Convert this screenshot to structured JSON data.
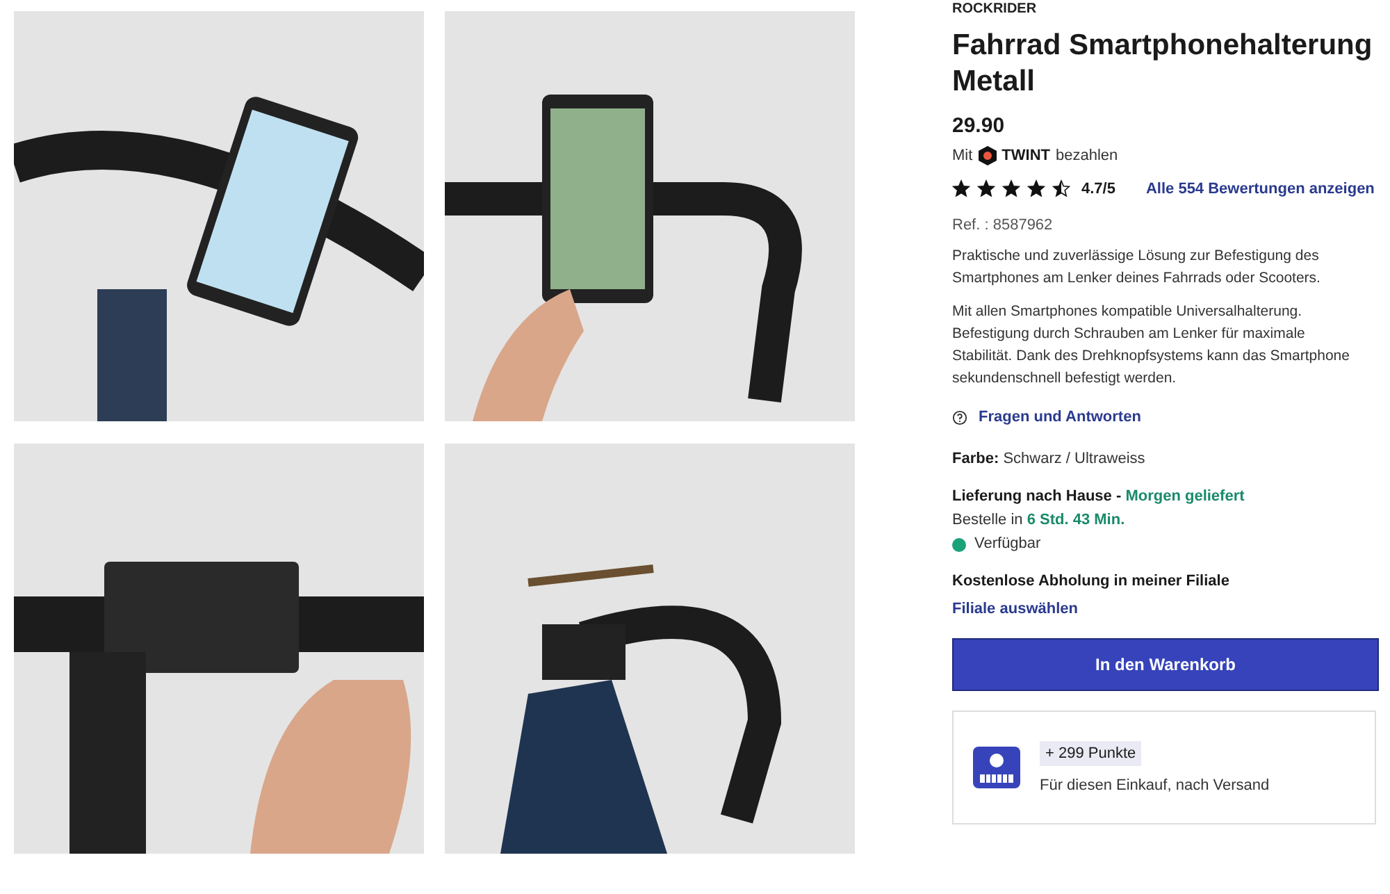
{
  "gallery": {
    "photos": [
      {
        "kind": "phone-on-handlebar"
      },
      {
        "kind": "hand-phone"
      },
      {
        "kind": "mount-closeup"
      },
      {
        "kind": "empty-mount"
      }
    ]
  },
  "product": {
    "brand": "ROCKRIDER",
    "title": "Fahrrad Smartphonehalterung Metall",
    "price": "29.90",
    "twint": {
      "prefix": "Mit",
      "brand": "TWINT",
      "suffix": "bezahlen"
    },
    "rating": {
      "stars": 4.5,
      "score": "4.7/5",
      "reviews_link": "Alle 554 Bewertungen anzeigen"
    },
    "ref": "Ref. : 8587962",
    "description": [
      "Praktische und zuverlässige Lösung zur Befestigung des Smartphones am Lenker deines Fahrrads oder Scooters.",
      "Mit allen Smartphones kompatible Universalhalterung. Befestigung durch Schrauben am Lenker für maximale Stabilität. Dank des Drehknopfsystems kann das Smartphone sekundenschnell befestigt werden."
    ],
    "qa_link": "Fragen und Antworten",
    "variant": {
      "label": "Farbe:",
      "value": "Schwarz / Ultraweiss"
    },
    "delivery": {
      "label": "Lieferung nach Hause -",
      "eta": "Morgen geliefert",
      "order_prefix": "Bestelle in",
      "countdown": "6 Std. 43 Min.",
      "availability": "Verfügbar",
      "available": true
    },
    "pickup": {
      "label": "Kostenlose Abholung in meiner Filiale",
      "link": "Filiale auswählen"
    },
    "cart_button": "In den Warenkorb",
    "points": {
      "badge": "+ 299 Punkte",
      "note": "Für diesen Einkauf, nach Versand"
    }
  }
}
